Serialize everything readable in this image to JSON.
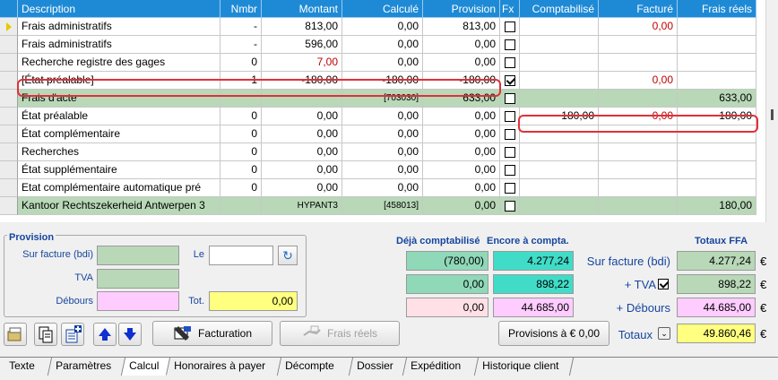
{
  "columns": [
    "Description",
    "Nmbr",
    "Montant",
    "Calculé",
    "Provision",
    "Fx",
    "Comptabilisé",
    "Facturé",
    "Frais réels"
  ],
  "rows": [
    {
      "indicator": true,
      "desc": "Frais administratifs",
      "nmbr": "-",
      "montant": "813,00",
      "calcule": "0,00",
      "provision": "813,00",
      "fx": false,
      "compta": "",
      "facture": "0,00",
      "facture_red": true,
      "frais": "",
      "green": false,
      "montant_red": false
    },
    {
      "indicator": false,
      "desc": "Frais administratifs",
      "nmbr": "-",
      "montant": "596,00",
      "calcule": "0,00",
      "provision": "0,00",
      "fx": false,
      "compta": "",
      "facture": "",
      "frais": "",
      "green": false
    },
    {
      "indicator": false,
      "desc": "Recherche registre des gages",
      "nmbr": "0",
      "montant": "7,00",
      "montant_red": true,
      "calcule": "0,00",
      "provision": "0,00",
      "fx": false,
      "compta": "",
      "facture": "",
      "frais": "",
      "green": false
    },
    {
      "indicator": false,
      "desc": "[État préalable]",
      "nmbr": "1",
      "montant": "-180,00",
      "calcule": "-180,00",
      "provision": "-180,00",
      "fx": true,
      "compta": "",
      "facture": "0,00",
      "facture_red": true,
      "frais": "",
      "green": false
    },
    {
      "indicator": false,
      "desc": "Frais d'acte",
      "nmbr": "",
      "montant": "",
      "calcule": "[703030]",
      "calcule_small": true,
      "provision": "633,00",
      "fx": false,
      "compta": "",
      "facture": "",
      "frais": "633,00",
      "green": true
    },
    {
      "indicator": false,
      "desc": "État préalable",
      "nmbr": "0",
      "montant": "0,00",
      "calcule": "0,00",
      "provision": "0,00",
      "fx": false,
      "compta": "180,00",
      "facture": "0,00",
      "facture_red": true,
      "frais": "180,00",
      "green": false
    },
    {
      "indicator": false,
      "desc": "État complémentaire",
      "nmbr": "0",
      "montant": "0,00",
      "calcule": "0,00",
      "provision": "0,00",
      "fx": false,
      "compta": "",
      "facture": "",
      "frais": "",
      "green": false
    },
    {
      "indicator": false,
      "desc": "Recherches",
      "nmbr": "0",
      "montant": "0,00",
      "calcule": "0,00",
      "provision": "0,00",
      "fx": false,
      "compta": "",
      "facture": "",
      "frais": "",
      "green": false
    },
    {
      "indicator": false,
      "desc": "État supplémentaire",
      "nmbr": "0",
      "montant": "0,00",
      "calcule": "0,00",
      "provision": "0,00",
      "fx": false,
      "compta": "",
      "facture": "",
      "frais": "",
      "green": false
    },
    {
      "indicator": false,
      "desc": "Etat complémentaire automatique pré",
      "nmbr": "0",
      "montant": "0,00",
      "calcule": "0,00",
      "provision": "0,00",
      "fx": false,
      "compta": "",
      "facture": "",
      "frais": "",
      "green": false
    },
    {
      "indicator": false,
      "desc": "Kantoor Rechtszekerheid Antwerpen 3",
      "nmbr": "",
      "montant": "HYPANT3",
      "montant_small": true,
      "calcule": "[458013]",
      "calcule_small": true,
      "provision": "0,00",
      "fx": false,
      "compta": "",
      "facture": "",
      "frais": "180,00",
      "green": true
    }
  ],
  "provision": {
    "title": "Provision",
    "sur_facture_label": "Sur facture (bdi)",
    "sur_facture_value": "",
    "tva_label": "TVA",
    "tva_value": "",
    "debours_label": "Débours",
    "debours_value": "",
    "le_label": "Le",
    "le_value": "",
    "tot_label": "Tot.",
    "tot_value": "0,00"
  },
  "summary": {
    "deja_label": "Déjà comptabilisé",
    "encore_label": "Encore à compta.",
    "totaux_ffa_label": "Totaux FFA",
    "sur_facture_label": "Sur facture (bdi)",
    "tva_label": "+ TVA",
    "tva_checked": true,
    "debours_label": "+ Débours",
    "totaux_label": "Totaux",
    "deja": [
      "(780,00)",
      "0,00",
      "0,00"
    ],
    "encore": [
      "4.277,24",
      "898,22",
      "44.685,00"
    ],
    "ffa": [
      "4.277,24",
      "898,22",
      "44.685,00"
    ],
    "totaux_value": "49.860,46",
    "currency": "€"
  },
  "toolbar": {
    "facturation_label": "Facturation",
    "frais_reels_label": "Frais réels",
    "provisions_label": "Provisions à € 0,00"
  },
  "tabs": [
    "Texte",
    "Paramètres",
    "Calcul",
    "Honoraires à payer",
    "Décompte",
    "Dossier",
    "Expédition",
    "Historique client"
  ],
  "active_tab": 2
}
